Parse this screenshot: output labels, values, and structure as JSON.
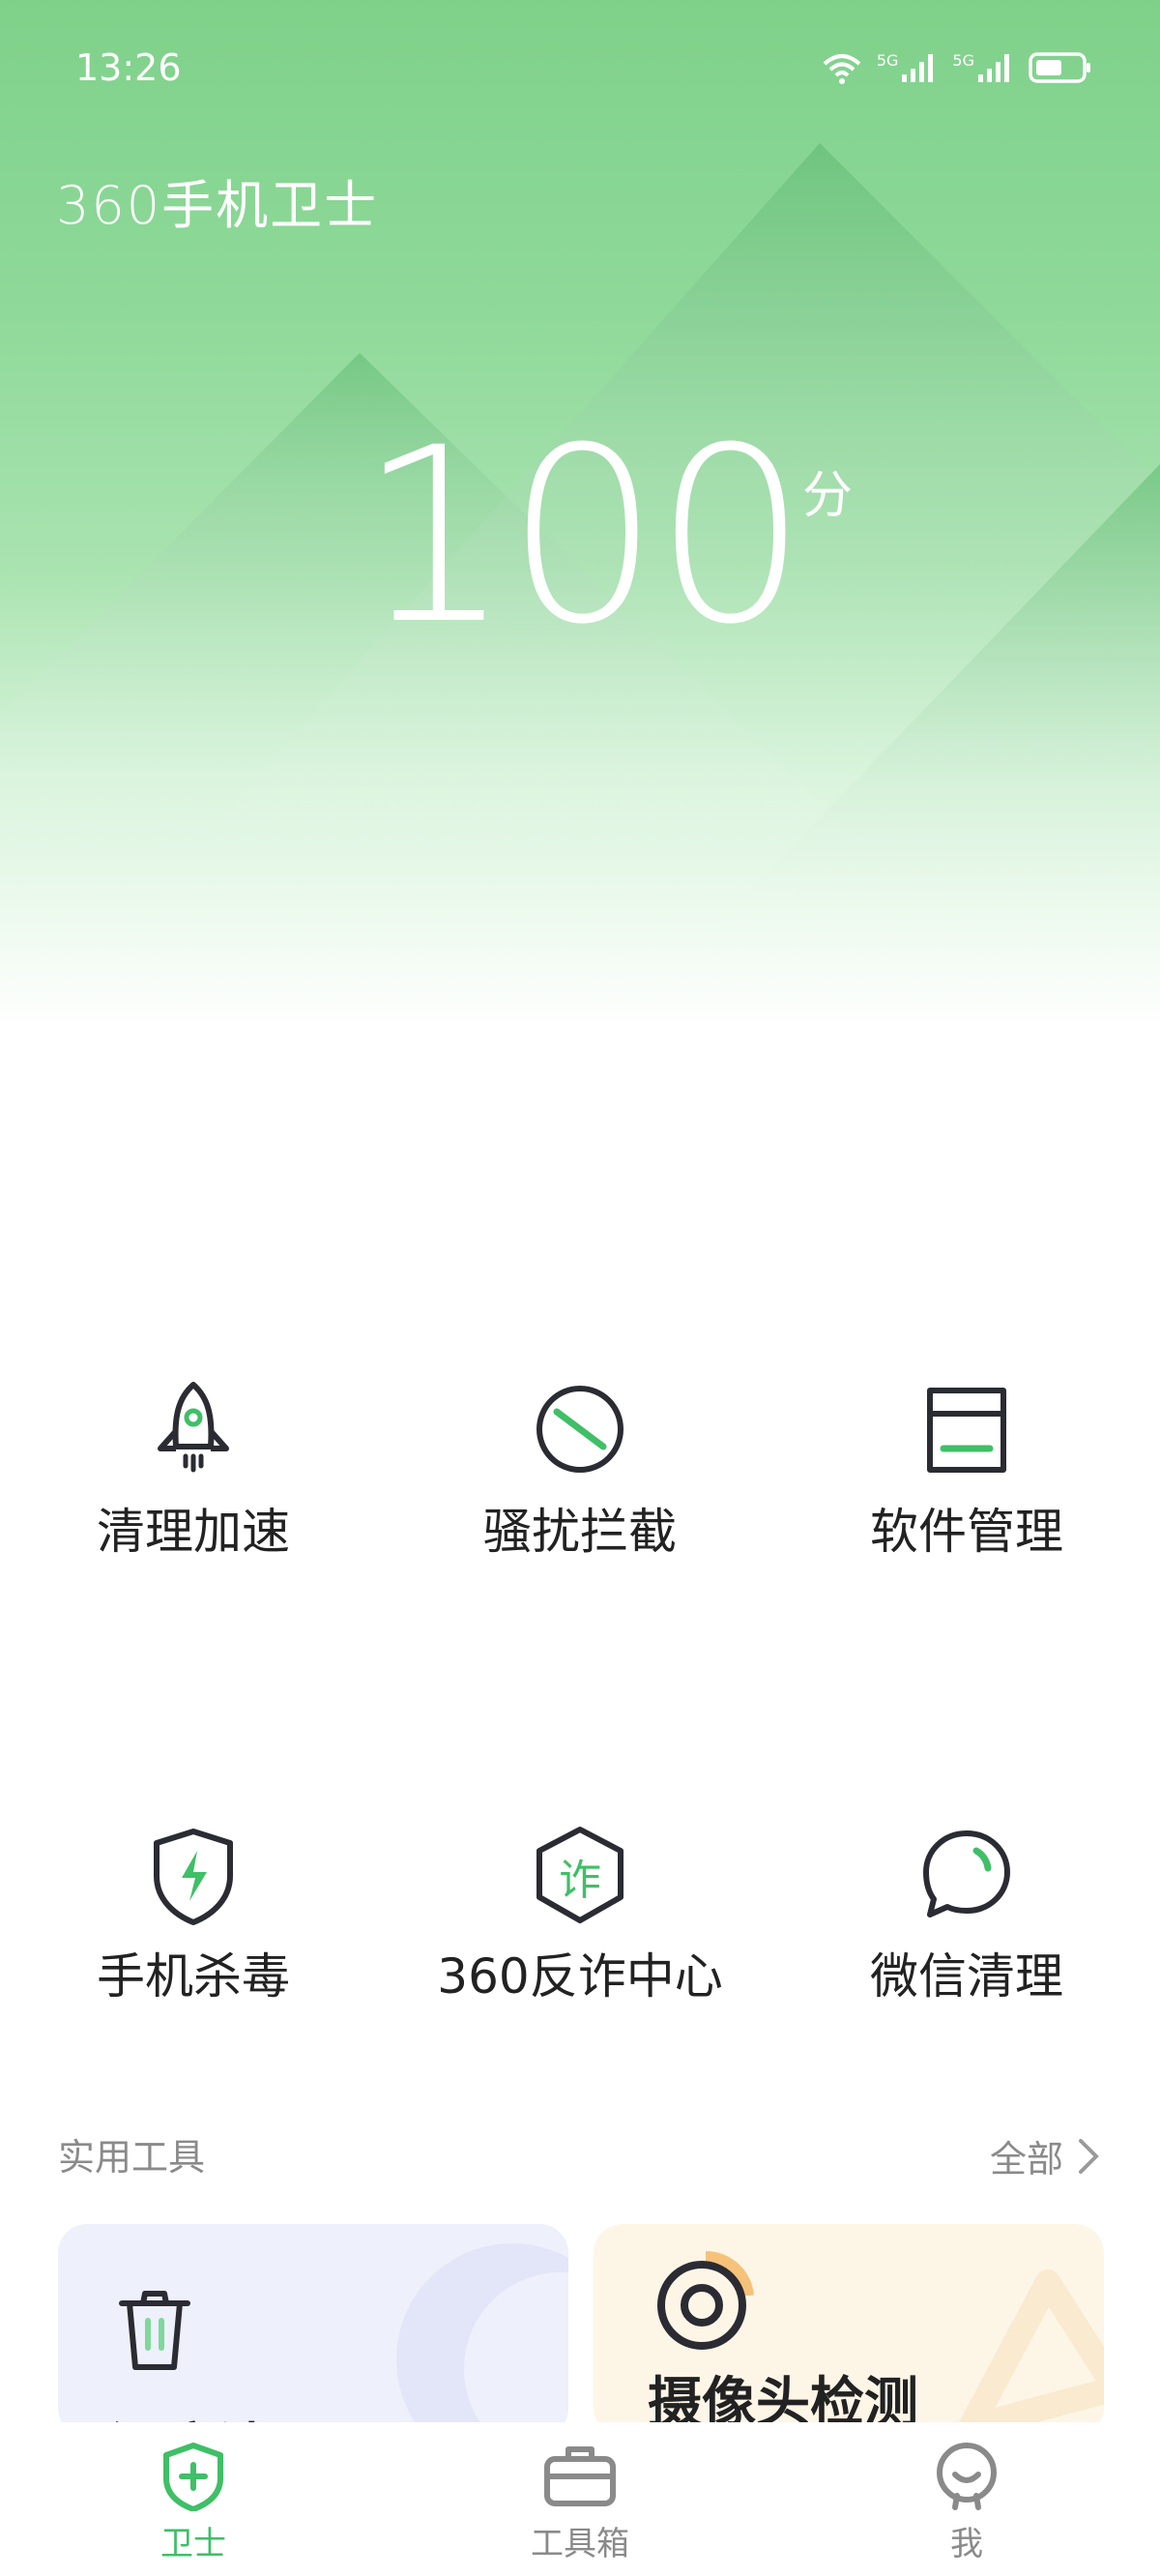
{
  "status_bar": {
    "time": "13:26",
    "network_1": "5G",
    "network_2": "5G"
  },
  "app": {
    "brand": "360手机卫士"
  },
  "score": {
    "value": "100",
    "unit": "分"
  },
  "features": [
    {
      "label": "清理加速",
      "icon": "rocket-icon"
    },
    {
      "label": "骚扰拦截",
      "icon": "block-icon"
    },
    {
      "label": "软件管理",
      "icon": "box-icon"
    },
    {
      "label": "手机杀毒",
      "icon": "shield-bolt-icon"
    },
    {
      "label": "360反诈中心",
      "icon": "anti-fraud-icon",
      "icon_text": "诈"
    },
    {
      "label": "微信清理",
      "icon": "chat-bubble-icon"
    }
  ],
  "tools": {
    "title": "实用工具",
    "all_label": "全部",
    "cards": [
      {
        "title": "深度清理",
        "icon": "trash-icon"
      },
      {
        "title": "摄像头检测",
        "icon": "camera-target-icon"
      }
    ]
  },
  "bottom_nav": [
    {
      "label": "卫士",
      "icon": "shield-plus-icon",
      "active": true
    },
    {
      "label": "工具箱",
      "icon": "toolbox-icon",
      "active": false
    },
    {
      "label": "我",
      "icon": "profile-icon",
      "active": false
    }
  ],
  "colors": {
    "accent": "#3fbf66",
    "hero_top": "#7fd18a",
    "icon_dark": "#2b2b33"
  }
}
